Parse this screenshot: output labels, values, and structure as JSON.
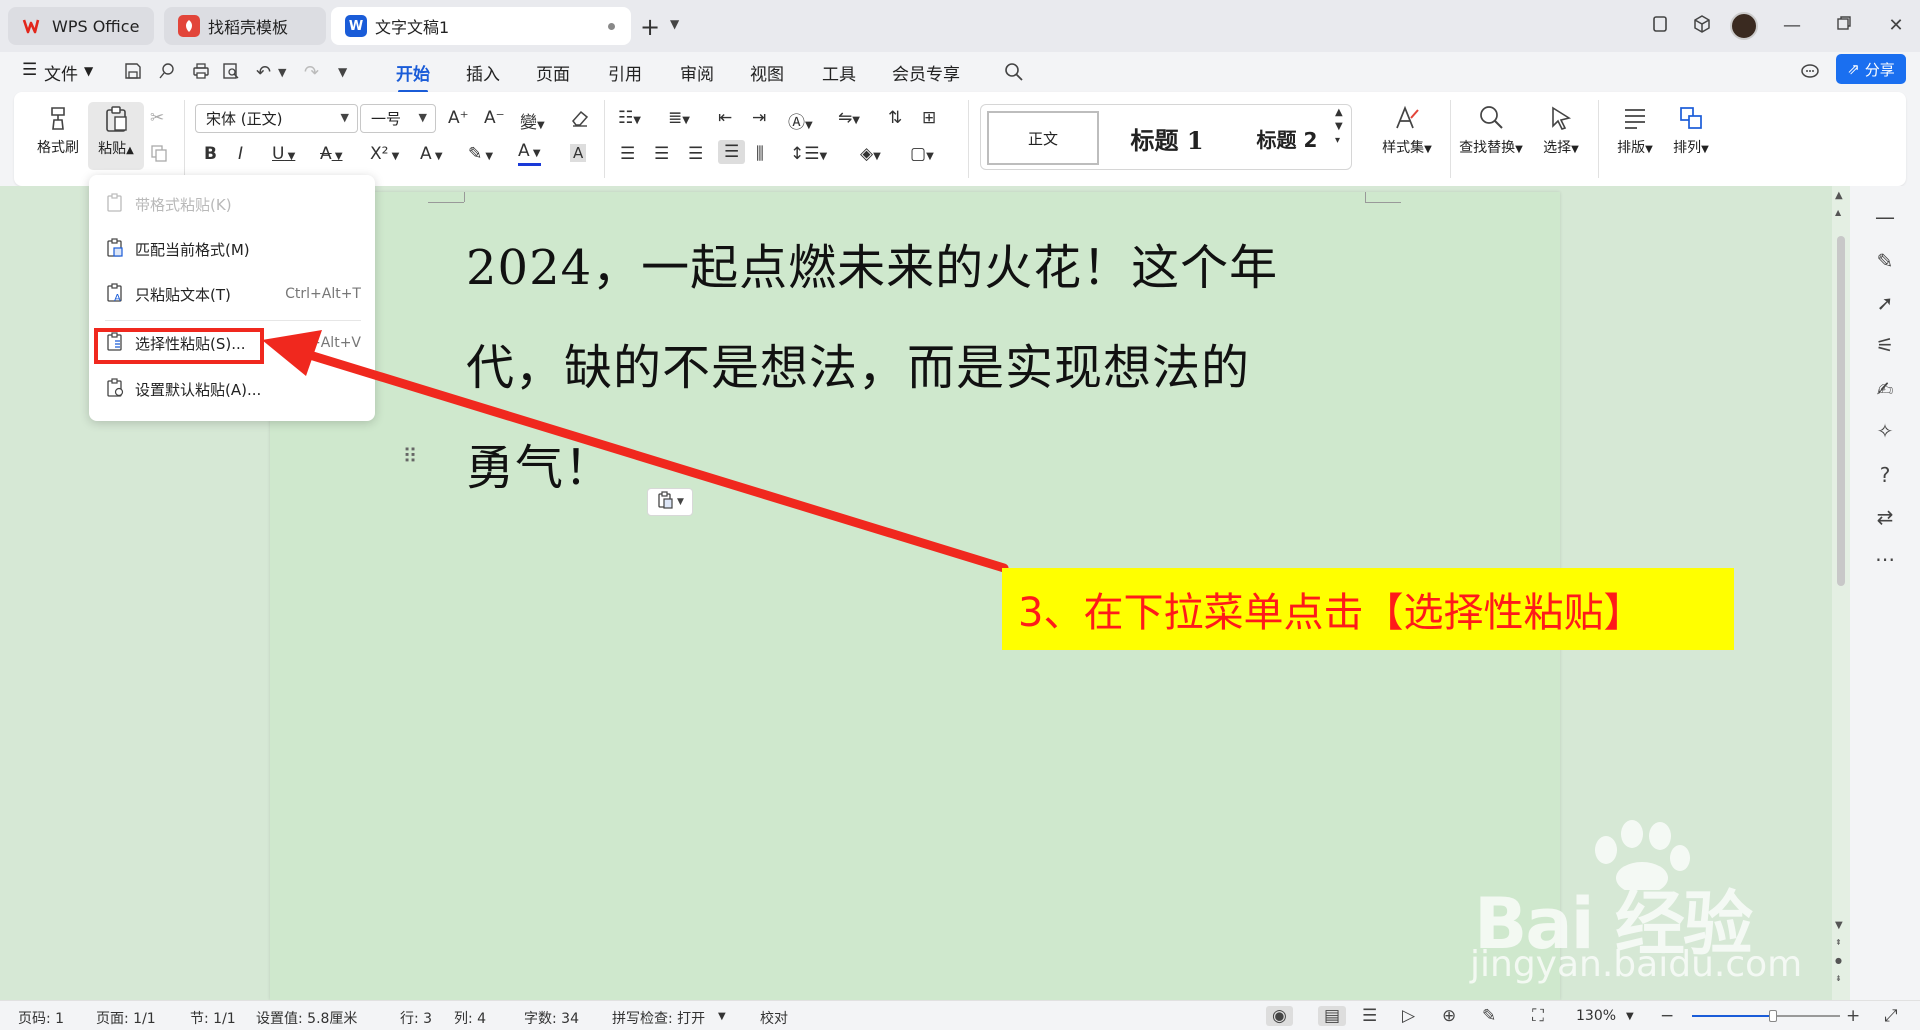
{
  "titlebar": {
    "tabs": [
      {
        "label": "WPS Office",
        "icon": "wps-logo-icon"
      },
      {
        "label": "找稻壳模板",
        "icon": "docer-logo-icon"
      },
      {
        "label": "文字文稿1",
        "icon": "word-doc-icon"
      }
    ],
    "new_tab": "+"
  },
  "menubar": {
    "file_label": "文件",
    "tabs": [
      "开始",
      "插入",
      "页面",
      "引用",
      "审阅",
      "视图",
      "工具",
      "会员专享"
    ],
    "active_tab": "开始",
    "share_label": "分享"
  },
  "ribbon": {
    "format_painter": "格式刷",
    "paste": "粘贴",
    "font_name": "宋体 (正文)",
    "font_size": "一号",
    "styles": {
      "normal": "正文",
      "h1": "标题 1",
      "h2": "标题 2"
    },
    "style_set": "样式集",
    "find_replace": "查找替换",
    "select": "选择",
    "layout": "排版",
    "arrange": "排列",
    "accent_color": "#1a5cd8",
    "font_color_bar": "#1a3ad8"
  },
  "document": {
    "lines": [
      "2024，一起点燃未来的火花！这个年",
      "代，缺的不是想法，而是实现想法的",
      "勇气！"
    ]
  },
  "paste_menu": {
    "items": [
      {
        "label": "带格式粘贴(K)",
        "shortcut": "",
        "disabled": true
      },
      {
        "label": "匹配当前格式(M)",
        "shortcut": ""
      },
      {
        "label": "只粘贴文本(T)",
        "shortcut": "Ctrl+Alt+T"
      },
      {
        "label": "选择性粘贴(S)...",
        "shortcut": "Ctrl+Alt+V"
      },
      {
        "label": "设置默认粘贴(A)...",
        "shortcut": ""
      }
    ]
  },
  "annotation": {
    "text": "3、在下拉菜单点击【选择性粘贴】",
    "bg_color": "#ffff00",
    "text_color": "#ff1a1a",
    "arrow_color": "#f0281e"
  },
  "watermark": {
    "brand": "Bai 经验",
    "url": "jingyan.baidu.com"
  },
  "statusbar": {
    "page_num": "页码: 1",
    "pages": "页面: 1/1",
    "section": "节: 1/1",
    "setting": "设置值: 5.8厘米",
    "row": "行: 3",
    "col": "列: 4",
    "words": "字数: 34",
    "spell": "拼写检查: 打开",
    "proof": "校对",
    "zoom": "130%",
    "zoom_fraction": 0.55
  }
}
